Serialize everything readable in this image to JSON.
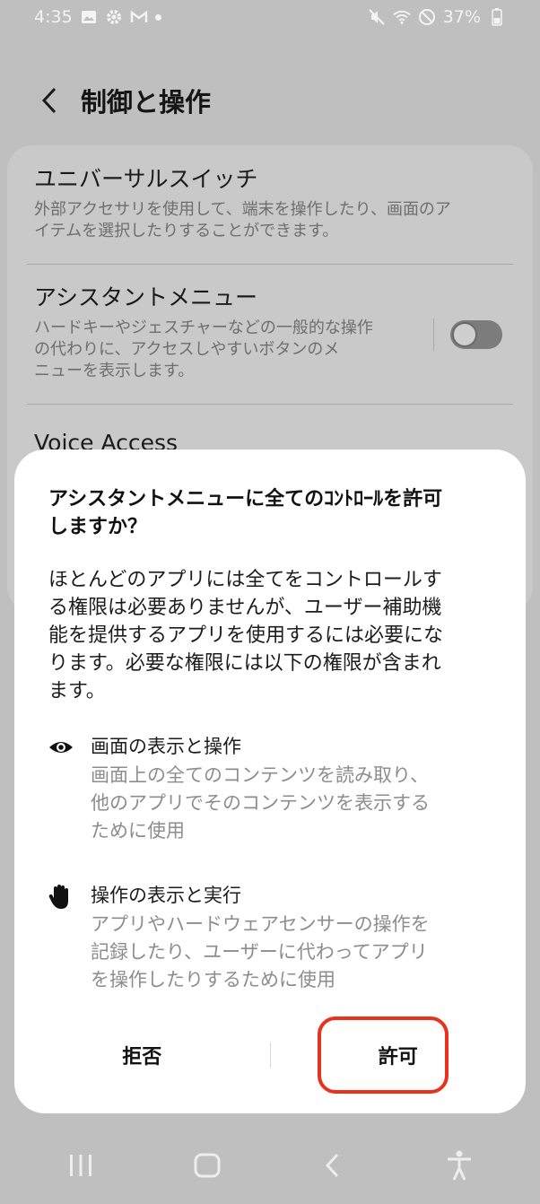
{
  "status_bar": {
    "time": "4:35",
    "battery": "37%"
  },
  "header": {
    "title": "制御と操作"
  },
  "settings": {
    "items": [
      {
        "title": "ユニバーサルスイッチ",
        "description_line1": "外部アクセサリを使用して、端末を操作したり、画面のア",
        "description_line2": "イテムを選択したりすることができます。"
      },
      {
        "title": "アシスタントメニュー",
        "description_line1": "ハードキーやジェスチャーなどの一般的な操作",
        "description_line2": "の代わりに、アクセスしやすいボタンのメ",
        "description_line3": "ニューを表示します。",
        "toggle": "off"
      },
      {
        "title": "Voice Access"
      }
    ]
  },
  "dialog": {
    "title_line1": "アシスタントメニューに全てのｺﾝﾄﾛｰﾙを許可",
    "title_line2": "しますか？",
    "body_lines": [
      "ほとんどのアプリには全てをコントロールす",
      "る権限は必要ありませんが、ユーザー補助機",
      "能を提供するアプリを使用するには必要にな",
      "ります。必要な権限には以下の権限が含まれ",
      "ます。"
    ],
    "permissions": [
      {
        "icon": "eye-icon",
        "title": "画面の表示と操作",
        "desc_lines": [
          "画面上の全てのコンテンツを読み取り、",
          "他のアプリでそのコンテンツを表示する",
          "ために使用"
        ]
      },
      {
        "icon": "hand-icon",
        "title": "操作の表示と実行",
        "desc_lines": [
          "アプリやハードウェアセンサーの操作を",
          "記録したり、ユーザーに代わってアプリ",
          "を操作したりするために使用"
        ]
      }
    ],
    "deny_label": "拒否",
    "allow_label": "許可",
    "highlight_color": "#e8321e"
  }
}
